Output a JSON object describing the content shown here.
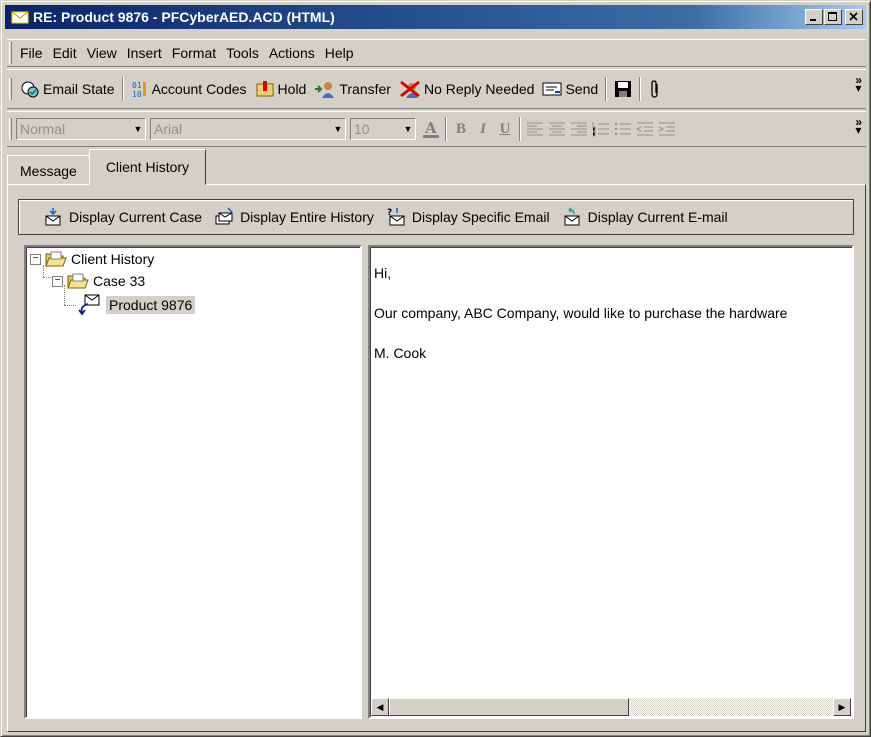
{
  "window": {
    "title": "RE: Product 9876 - PFCyberAED.ACD (HTML)",
    "titlebar_colors": {
      "start": "#0a246a",
      "end": "#a6caf0"
    }
  },
  "menu": {
    "items": [
      {
        "label": "File"
      },
      {
        "label": "Edit"
      },
      {
        "label": "View"
      },
      {
        "label": "Insert"
      },
      {
        "label": "Format"
      },
      {
        "label": "Tools"
      },
      {
        "label": "Actions"
      },
      {
        "label": "Help"
      }
    ]
  },
  "toolbar": {
    "email_state": "Email State",
    "account_codes": "Account Codes",
    "hold": "Hold",
    "transfer": "Transfer",
    "no_reply": "No Reply Needed",
    "send": "Send",
    "overflow": "»"
  },
  "format_bar": {
    "style": "Normal",
    "font": "Arial",
    "size": "10",
    "bold": "B",
    "italic": "I",
    "underline": "U"
  },
  "tabs": [
    {
      "label": "Message",
      "active": false
    },
    {
      "label": "Client History",
      "active": true
    }
  ],
  "history_toolbar": {
    "display_current_case": "Display Current Case",
    "display_entire_history": "Display Entire History",
    "display_specific_email": "Display Specific Email",
    "display_current_email": "Display Current E-mail"
  },
  "tree": {
    "root": "Client History",
    "case": "Case 33",
    "email": "Product 9876",
    "expander_symbol": "−"
  },
  "message": {
    "lines": [
      "Hi,",
      "Our company, ABC Company, would like to purchase the hardware",
      "M. Cook"
    ]
  }
}
